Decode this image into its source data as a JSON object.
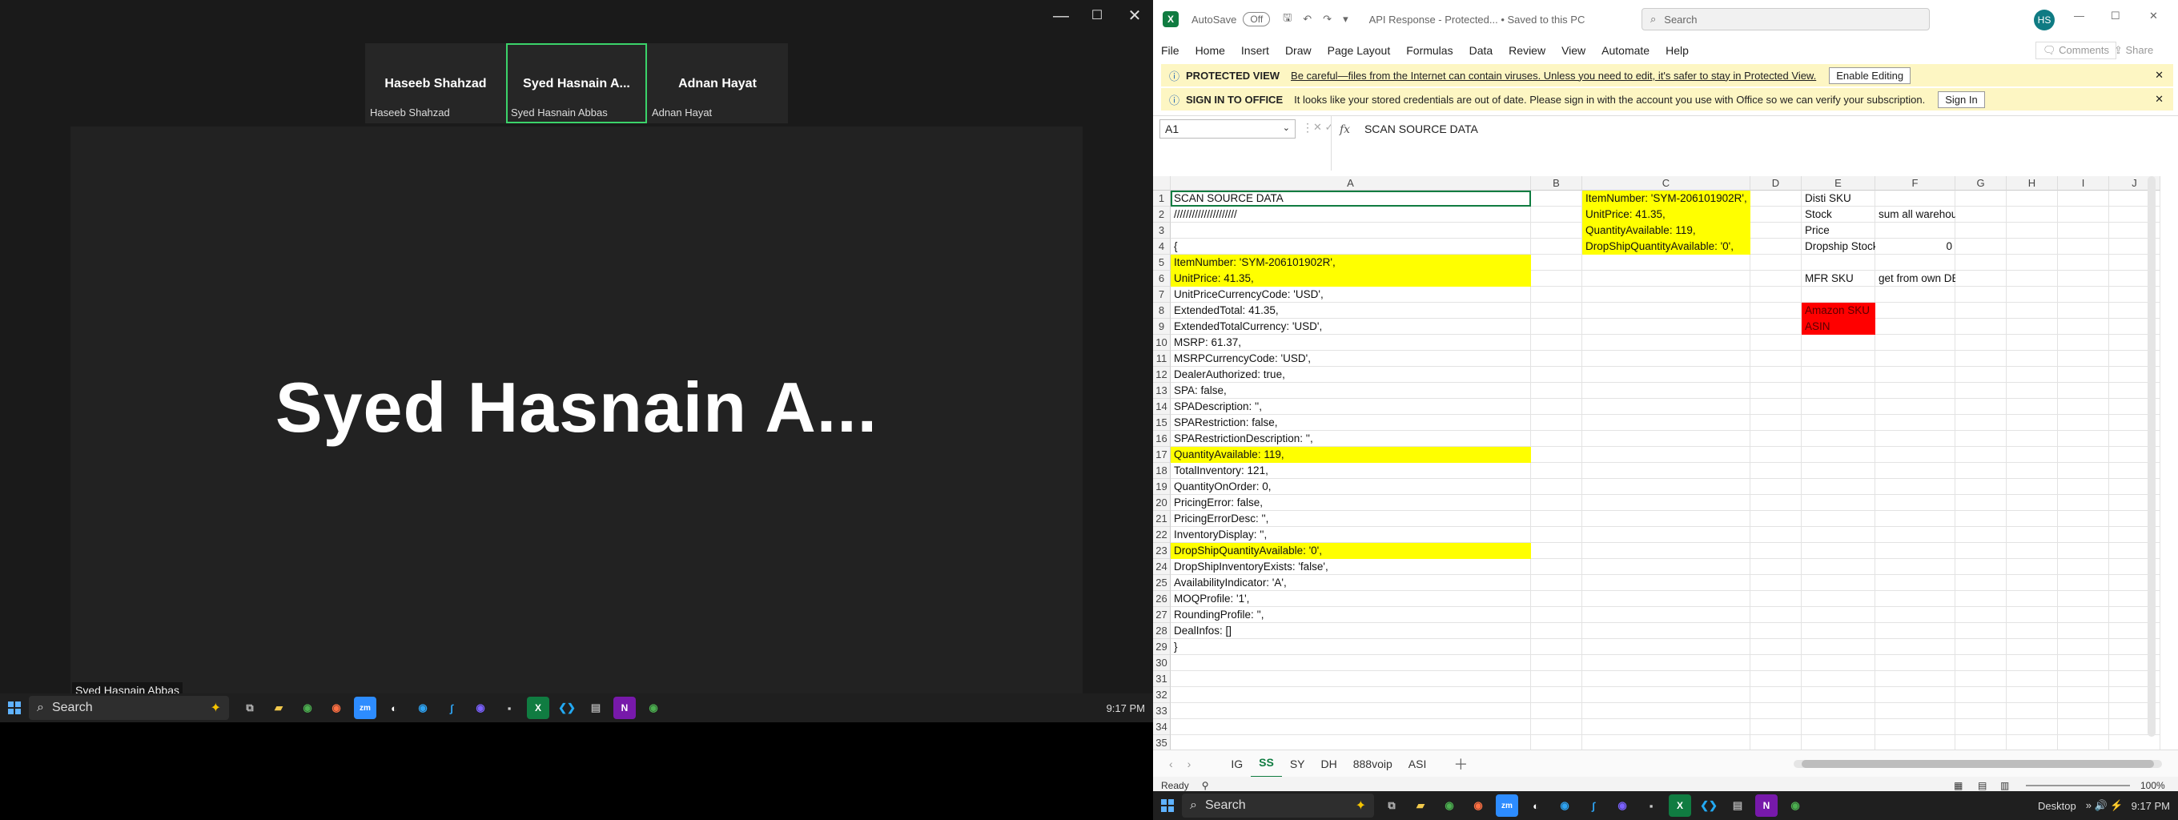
{
  "zoom": {
    "window_controls": [
      "—",
      "☐",
      "✕"
    ],
    "tiles": [
      {
        "name": "Haseeb Shahzad",
        "label": "Haseeb Shahzad",
        "active": false
      },
      {
        "name": "Syed Hasnain A...",
        "label": "Syed Hasnain Abbas",
        "active": true
      },
      {
        "name": "Adnan Hayat",
        "label": "Adnan Hayat",
        "active": false
      }
    ],
    "stage_name": "Syed Hasnain A...",
    "stage_label": "Syed Hasnain Abbas"
  },
  "taskbar_left": {
    "search": "Search",
    "clock": "9:17 PM"
  },
  "excel": {
    "title": {
      "autosave": "AutoSave",
      "autosave_state": "Off",
      "doc": "API Response  -  Protected...  •  Saved to this PC",
      "search": "Search",
      "avatar": "HS"
    },
    "ribbon": {
      "tabs": [
        "File",
        "Home",
        "Insert",
        "Draw",
        "Page Layout",
        "Formulas",
        "Data",
        "Review",
        "View",
        "Automate",
        "Help"
      ],
      "comments": "Comments",
      "share": "Share"
    },
    "protected_bar": {
      "title": "PROTECTED VIEW",
      "message": "Be careful—files from the Internet can contain viruses. Unless you need to edit, it's safer to stay in Protected View.",
      "button": "Enable Editing"
    },
    "signin_bar": {
      "title": "SIGN IN TO OFFICE",
      "message": "It looks like your stored credentials are out of date. Please sign in with the account you use with Office so we can verify your subscription.",
      "button": "Sign In"
    },
    "namebox": "A1",
    "formula": "SCAN SOURCE DATA",
    "columns": [
      "A",
      "B",
      "C",
      "D",
      "E",
      "F",
      "G",
      "H",
      "I",
      "J"
    ],
    "rows": [
      "1",
      "2",
      "3",
      "4",
      "5",
      "6",
      "7",
      "8",
      "9",
      "10",
      "11",
      "12",
      "13",
      "14",
      "15",
      "16",
      "17",
      "18",
      "19",
      "20",
      "21",
      "22",
      "23",
      "24",
      "25",
      "26",
      "27",
      "28",
      "29",
      "30",
      "31",
      "32",
      "33",
      "34",
      "35"
    ],
    "colA": [
      "SCAN SOURCE DATA",
      "/////////////////////",
      "{",
      "  ItemNumber: 'SYM-206101902R',",
      "  UnitPrice: 41.35,",
      "  UnitPriceCurrencyCode: 'USD',",
      "  ExtendedTotal: 41.35,",
      "  ExtendedTotalCurrency: 'USD',",
      "  MSRP: 61.37,",
      "  MSRPCurrencyCode: 'USD',",
      "  DealerAuthorized: true,",
      "  SPA: false,",
      "  SPADescription: '',",
      "  SPARestriction: false,",
      "  SPARestrictionDescription: '',",
      "  QuantityAvailable: 119,",
      "  TotalInventory: 121,",
      "  QuantityOnOrder: 0,",
      "  PricingError: false,",
      "  PricingErrorDesc: '',",
      "  InventoryDisplay: '',",
      "  DropShipQuantityAvailable: '0',",
      "  DropShipInventoryExists: 'false',",
      "  AvailabilityIndicator: 'A',",
      "  MOQProfile: '1',",
      "  RoundingProfile: '',",
      "  DealInfos: []",
      "}"
    ],
    "colA_rows": [
      1,
      2,
      4,
      5,
      6,
      7,
      8,
      9,
      10,
      11,
      12,
      13,
      14,
      15,
      16,
      17,
      18,
      19,
      20,
      21,
      22,
      23,
      24,
      25,
      26,
      27,
      28,
      29
    ],
    "colC": [
      "ItemNumber: 'SYM-206101902R',",
      "UnitPrice: 41.35,",
      "QuantityAvailable: 119,",
      "DropShipQuantityAvailable: '0',"
    ],
    "colE": {
      "r1": "Disti SKU",
      "r2": "Stock",
      "r3": "Price",
      "r4": "Dropship Stock",
      "r6": "MFR SKU",
      "r8": "Amazon SKU",
      "r9": "ASIN"
    },
    "colF": {
      "r2": "sum all warehouse",
      "r4": "0",
      "r6": "get from own DB"
    },
    "sheets": [
      "IG",
      "SS",
      "SY",
      "DH",
      "888voip",
      "ASI"
    ],
    "active_sheet": "SS",
    "status": {
      "ready": "Ready",
      "zoom": "100%"
    },
    "colors": {
      "highlight": "#ffff00",
      "red": "#ff0000",
      "excel_green": "#107c41"
    }
  },
  "taskbar_right": {
    "search": "Search",
    "desktop": "Desktop",
    "clock": "9:17 PM"
  }
}
